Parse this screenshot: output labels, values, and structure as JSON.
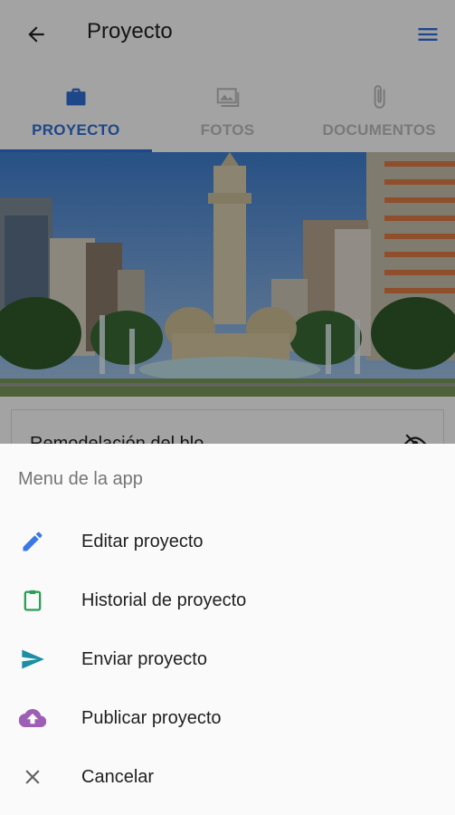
{
  "appbar": {
    "title": "Proyecto",
    "back_icon": "arrow-left-icon",
    "menu_icon": "hamburger-menu-icon"
  },
  "tabs": [
    {
      "label": "PROYECTO",
      "icon": "briefcase-icon",
      "active": true
    },
    {
      "label": "FOTOS",
      "icon": "image-icon",
      "active": false
    },
    {
      "label": "DOCUMENTOS",
      "icon": "paperclip-icon",
      "active": false
    }
  ],
  "card": {
    "title": "Remodelación del blo",
    "icon": "visibility-off-icon"
  },
  "sheet": {
    "title": "Menu de la app",
    "items": [
      {
        "label": "Editar proyecto",
        "icon": "pencil-icon",
        "color": "#3b78e7"
      },
      {
        "label": "Historial de proyecto",
        "icon": "clipboard-icon",
        "color": "#2e9e57"
      },
      {
        "label": "Enviar proyecto",
        "icon": "send-icon",
        "color": "#1a8fa3"
      },
      {
        "label": "Publicar proyecto",
        "icon": "cloud-upload-icon",
        "color": "#9c5fb5"
      },
      {
        "label": "Cancelar",
        "icon": "close-icon",
        "color": "#616161"
      }
    ]
  },
  "colors": {
    "accent": "#2f6fd6",
    "inactive_tab": "#bdbdbd"
  }
}
